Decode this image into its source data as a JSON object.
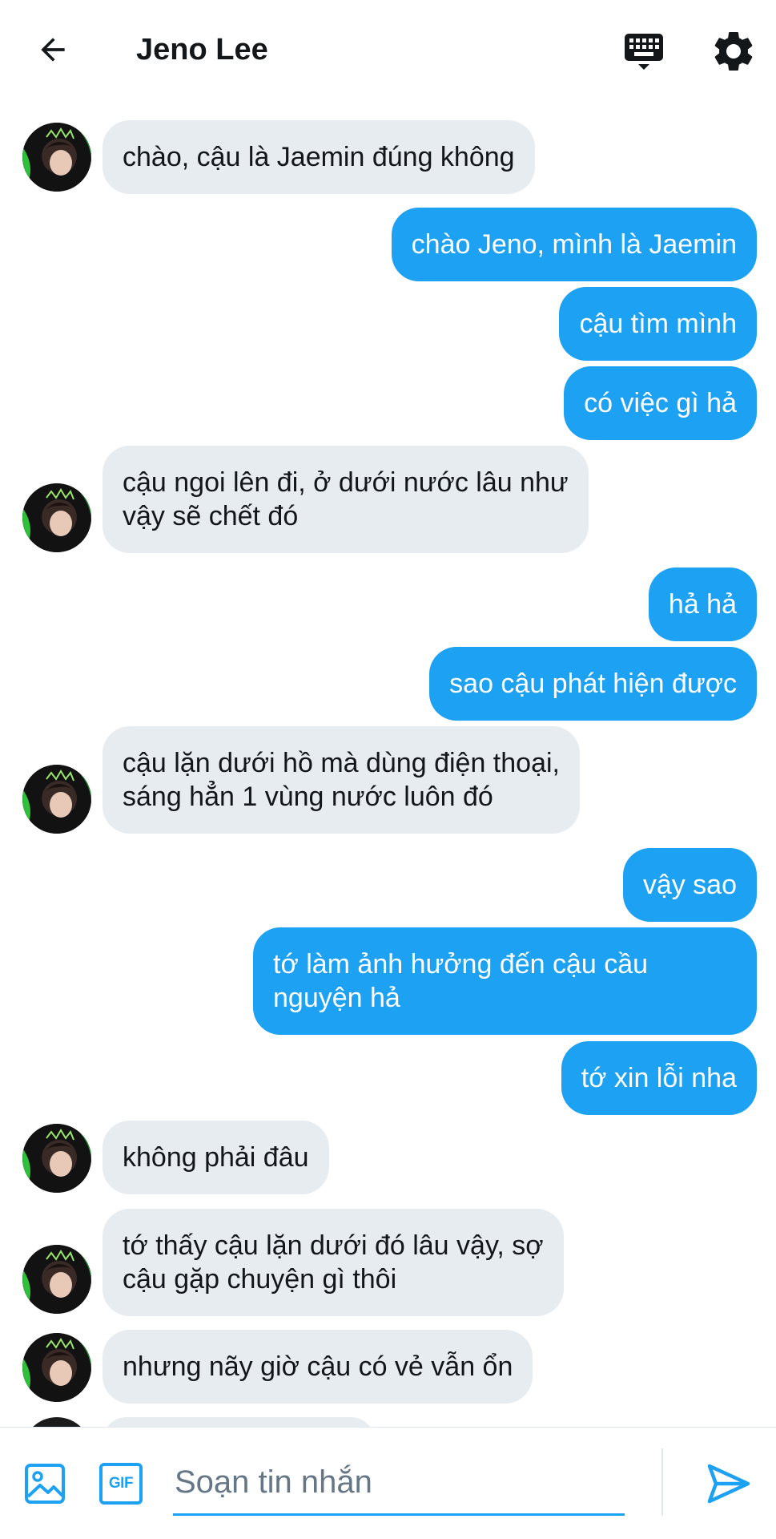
{
  "header": {
    "title": "Jeno Lee",
    "icons": {
      "back": "arrow-left-icon",
      "keyboard": "keyboard-icon",
      "settings": "gear-icon"
    }
  },
  "conversation": {
    "messages": [
      {
        "direction": "incoming",
        "text": "chào, cậu là Jaemin đúng không"
      },
      {
        "direction": "outgoing",
        "text": "chào Jeno, mình là Jaemin"
      },
      {
        "direction": "outgoing",
        "text": "cậu tìm mình"
      },
      {
        "direction": "outgoing",
        "text": "có việc gì hả"
      },
      {
        "direction": "incoming",
        "text": "cậu ngoi lên đi, ở dưới nước lâu như vậy sẽ chết đó"
      },
      {
        "direction": "outgoing",
        "text": "hả hả"
      },
      {
        "direction": "outgoing",
        "text": "sao cậu phát hiện được"
      },
      {
        "direction": "incoming",
        "text": "cậu lặn dưới hồ mà dùng điện thoại, sáng hẳn 1 vùng nước luôn đó"
      },
      {
        "direction": "outgoing",
        "text": "vậy sao"
      },
      {
        "direction": "outgoing",
        "text": "tớ làm ảnh hưởng đến cậu cầu nguyện hả"
      },
      {
        "direction": "outgoing",
        "text": "tớ xin lỗi nha"
      },
      {
        "direction": "incoming",
        "text": "không phải đâu"
      },
      {
        "direction": "incoming",
        "text": "tớ thấy cậu lặn dưới đó lâu vậy, sợ cậu gặp chuyện gì thôi"
      },
      {
        "direction": "incoming",
        "text": "nhưng nãy giờ cậu có vẻ vẫn ổn"
      }
    ],
    "bubble_lines": {
      "m4_l1": "cậu ngoi lên đi, ở dưới nước lâu như",
      "m4_l2": "vậy sẽ chết đó",
      "m7_l1": "cậu lặn dưới hồ mà dùng điện thoại,",
      "m7_l2": "sáng hẳn 1 vùng nước luôn đó",
      "m9_l1": "tớ làm ảnh hưởng đến cậu cầu",
      "m9_l2": "nguyện hả",
      "m12_l1": "tớ thấy cậu lặn dưới đó lâu vậy, sợ",
      "m12_l2": "cậu gặp chuyện gì thôi"
    }
  },
  "composer": {
    "placeholder": "Soạn tin nhắn",
    "gif_label": "GIF",
    "icons": {
      "image": "image-icon",
      "gif": "gif-icon",
      "send": "send-icon"
    }
  },
  "colors": {
    "accent": "#1da1f2",
    "incoming_bubble": "#e6ecf0",
    "text": "#14171a",
    "placeholder": "#657786"
  }
}
